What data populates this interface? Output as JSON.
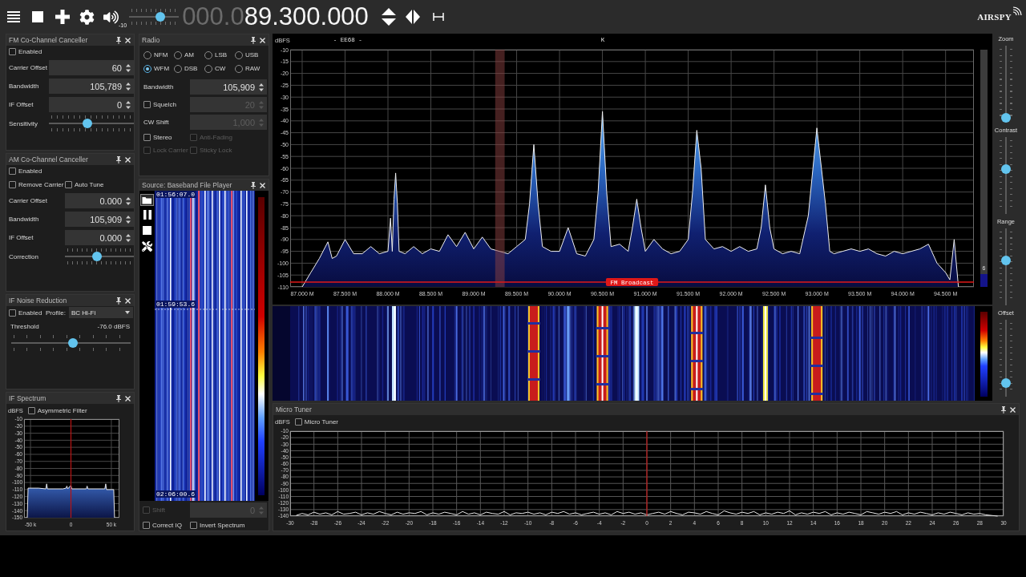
{
  "toolbar": {
    "volume": {
      "reading": "-10",
      "level": 0.65
    },
    "frequency": {
      "leading": "000.0",
      "value": "89.300.000"
    },
    "logo": "AIRSPY"
  },
  "left_panels": [
    {
      "kind": "form",
      "title": "FM Co-Channel Canceller",
      "rows": [
        {
          "kind": "checkbox",
          "label": "Enabled",
          "checked": false,
          "disabled": false
        },
        {
          "kind": "spin",
          "label": "Carrier Offset",
          "value": "60",
          "disabled": false
        },
        {
          "kind": "spin",
          "label": "Bandwidth",
          "value": "105,789",
          "disabled": false
        },
        {
          "kind": "spin",
          "label": "IF Offset",
          "value": "0",
          "disabled": false
        },
        {
          "kind": "slider",
          "label": "Sensitivity",
          "level": 0.45
        }
      ]
    },
    {
      "kind": "form",
      "title": "AM Co-Channel Canceller",
      "rows": [
        {
          "kind": "checkbox",
          "label": "Enabled",
          "checked": false,
          "disabled": false
        },
        {
          "kind": "checkboxes",
          "items": [
            {
              "label": "Remove Carrier",
              "checked": false,
              "disabled": false
            },
            {
              "label": "Auto Tune",
              "checked": false,
              "disabled": false
            }
          ]
        },
        {
          "kind": "spin",
          "label": "Carrier Offset",
          "value": "0.000",
          "disabled": false
        },
        {
          "kind": "spin",
          "label": "Bandwidth",
          "value": "105,909",
          "disabled": false
        },
        {
          "kind": "spin",
          "label": "IF Offset",
          "value": "0.000",
          "disabled": false
        },
        {
          "kind": "slider",
          "label": "Correction",
          "level": 0.46
        }
      ]
    },
    {
      "kind": "form",
      "title": "IF Noise Reduction",
      "rows": [
        {
          "kind": "checkbox_dropdown",
          "checkbox": {
            "label": "Enabled",
            "checked": false,
            "disabled": false
          },
          "label": "Profile:",
          "value": "BC Hi-Fi"
        },
        {
          "kind": "reading",
          "label": "Threshold",
          "value": "-76.0 dBFS"
        },
        {
          "kind": "slider",
          "level": 0.52
        }
      ]
    },
    {
      "kind": "chart",
      "title": "IF Spectrum",
      "checkbox": {
        "label": "Asymmetric Filter",
        "checked": false,
        "disabled": false
      },
      "chart_data": {
        "type": "area",
        "ylabel": "dBFS",
        "x": [
          -54,
          -53,
          -40,
          -31,
          -30,
          -29,
          -10,
          -6,
          -5,
          -4,
          0,
          1,
          19,
          20,
          21,
          42,
          43,
          44,
          53,
          54
        ],
        "values": [
          -150,
          -108,
          -108,
          -109,
          -102,
          -109,
          -109,
          -108,
          -105,
          -109,
          -104,
          -109,
          -109,
          -105,
          -109,
          -109,
          -102,
          -110,
          -110,
          -150
        ],
        "color": "#e6e6e6",
        "xlim": [
          -58,
          60
        ],
        "ylim": [
          -150,
          -10
        ],
        "xticks": [
          {
            "value": -50,
            "label": "-50 k"
          },
          {
            "value": 0,
            "label": "0"
          },
          {
            "value": 50,
            "label": "50 k"
          }
        ],
        "yticks": [
          -10,
          -20,
          -30,
          -40,
          -50,
          -60,
          -70,
          -80,
          -90,
          -100,
          -110,
          -120,
          -130,
          -140,
          -150
        ],
        "grid": true,
        "ref_lines": [
          {
            "axis": "x",
            "value": 0,
            "color": "#b81414"
          }
        ]
      }
    }
  ],
  "middle_panels": [
    {
      "kind": "form",
      "title": "Radio",
      "rows": [
        {
          "kind": "radios",
          "items": [
            {
              "label": "NFM",
              "selected": false
            },
            {
              "label": "AM",
              "selected": false
            },
            {
              "label": "LSB",
              "selected": false
            },
            {
              "label": "USB",
              "selected": false
            },
            {
              "label": "WFM",
              "selected": true
            },
            {
              "label": "DSB",
              "selected": false
            },
            {
              "label": "CW",
              "selected": false
            },
            {
              "label": "RAW",
              "selected": false
            }
          ]
        },
        {
          "kind": "spin",
          "label": "Bandwidth",
          "value": "105,909",
          "disabled": false
        },
        {
          "kind": "check_spin",
          "checkbox": {
            "label": "Squelch",
            "checked": false,
            "disabled": false
          },
          "value": "20",
          "disabled": true
        },
        {
          "kind": "spin",
          "label": "CW Shift",
          "value": "1,000",
          "disabled": true
        },
        {
          "kind": "checkboxes",
          "items": [
            {
              "label": "Stereo",
              "checked": false,
              "disabled": false
            },
            {
              "label": "Anti-Fading",
              "checked": false,
              "disabled": true
            }
          ]
        },
        {
          "kind": "checkboxes",
          "items": [
            {
              "label": "Lock Carrier",
              "checked": false,
              "disabled": true
            },
            {
              "label": "Sticky Lock",
              "checked": false,
              "disabled": true
            }
          ]
        }
      ]
    },
    {
      "kind": "player",
      "title": "Source: Baseband File Player",
      "timestamps": [
        "01:56:07.0",
        "01:59:53.6",
        "02:06:00.6"
      ],
      "rows": [
        {
          "kind": "check_spin",
          "checkbox": {
            "label": "Shift",
            "checked": false,
            "disabled": true
          },
          "value": "0",
          "disabled": true
        },
        {
          "kind": "checkboxes",
          "items": [
            {
              "label": "Correct IQ",
              "checked": false,
              "disabled": false
            },
            {
              "label": "Invert Spectrum",
              "checked": false,
              "disabled": false
            }
          ]
        }
      ]
    }
  ],
  "spectrum": {
    "chart_data": {
      "type": "area",
      "ylabel": "dBFS",
      "annotations": [
        "- EE68 -",
        "K"
      ],
      "x": [
        87,
        87.1,
        87.2,
        87.3,
        87.35,
        87.4,
        87.5,
        87.6,
        87.7,
        87.8,
        87.9,
        88,
        88.03,
        88.05,
        88.07,
        88.09,
        88.11,
        88.13,
        88.2,
        88.3,
        88.4,
        88.5,
        88.6,
        88.7,
        88.8,
        88.9,
        89,
        89.1,
        89.2,
        89.3,
        89.4,
        89.5,
        89.6,
        89.65,
        89.7,
        89.75,
        89.8,
        89.9,
        90,
        90.1,
        90.2,
        90.3,
        90.4,
        90.45,
        90.5,
        90.55,
        90.6,
        90.7,
        90.8,
        90.85,
        90.9,
        90.95,
        91,
        91.1,
        91.2,
        91.3,
        91.4,
        91.5,
        91.55,
        91.6,
        91.65,
        91.7,
        91.8,
        91.9,
        92,
        92.1,
        92.2,
        92.3,
        92.35,
        92.4,
        92.45,
        92.5,
        92.6,
        92.7,
        92.8,
        92.9,
        93,
        93.1,
        93.15,
        93.2,
        93.3,
        93.4,
        93.5,
        93.6,
        93.7,
        93.8,
        93.9,
        94,
        94.1,
        94.2,
        94.3,
        94.4,
        94.5,
        94.55,
        94.6,
        94.65
      ],
      "values": [
        -110,
        -104,
        -98,
        -91,
        -98,
        -97,
        -90,
        -96,
        -96,
        -93,
        -96,
        -95,
        -81,
        -95,
        -73,
        -62,
        -75,
        -95,
        -96,
        -93,
        -96,
        -94,
        -95,
        -88,
        -93,
        -87,
        -94,
        -89,
        -94,
        -95,
        -96,
        -93,
        -90,
        -75,
        -50,
        -75,
        -93,
        -95,
        -95,
        -85,
        -96,
        -97,
        -90,
        -70,
        -36,
        -70,
        -93,
        -92,
        -95,
        -85,
        -73,
        -85,
        -95,
        -90,
        -94,
        -96,
        -95,
        -90,
        -70,
        -44,
        -60,
        -90,
        -94,
        -93,
        -95,
        -93,
        -95,
        -94,
        -85,
        -67,
        -85,
        -94,
        -96,
        -95,
        -96,
        -80,
        -43,
        -75,
        -95,
        -96,
        -95,
        -94,
        -95,
        -94,
        -96,
        -97,
        -95,
        -96,
        -95,
        -94,
        -92,
        -100,
        -104,
        -107,
        -90,
        -110
      ],
      "color": "#f0f0f0",
      "xlim": [
        86.86,
        94.83
      ],
      "ylim": [
        -110,
        -10
      ],
      "xticks": [
        {
          "value": 87,
          "label": "87.000 M"
        },
        {
          "value": 87.5,
          "label": "87.500 M"
        },
        {
          "value": 88,
          "label": "88.000 M"
        },
        {
          "value": 88.5,
          "label": "88.500 M"
        },
        {
          "value": 89,
          "label": "89.000 M"
        },
        {
          "value": 89.5,
          "label": "89.500 M"
        },
        {
          "value": 90,
          "label": "90.000 M"
        },
        {
          "value": 90.5,
          "label": "90.500 M"
        },
        {
          "value": 91,
          "label": "91.000 M"
        },
        {
          "value": 91.5,
          "label": "91.500 M"
        },
        {
          "value": 92,
          "label": "92.000 M"
        },
        {
          "value": 92.5,
          "label": "92.500 M"
        },
        {
          "value": 93,
          "label": "93.000 M"
        },
        {
          "value": 93.5,
          "label": "93.500 M"
        },
        {
          "value": 94,
          "label": "94.000 M"
        },
        {
          "value": 94.5,
          "label": "94.500 M"
        }
      ],
      "yticks": [
        -10,
        -15,
        -20,
        -25,
        -30,
        -35,
        -40,
        -45,
        -50,
        -55,
        -60,
        -65,
        -70,
        -75,
        -80,
        -85,
        -90,
        -95,
        -100,
        -105,
        -110
      ],
      "grid": true,
      "bands": [
        {
          "axis": "x",
          "from": 89.25,
          "to": 89.36,
          "color": "#8a4040"
        }
      ],
      "ref_lines": [
        {
          "axis": "y",
          "value": -108,
          "label": "FM Broadcast",
          "color": "#e01818"
        }
      ]
    },
    "meter": {
      "reading": "6",
      "level": 0.054
    }
  },
  "display_sliders": [
    {
      "label": "Zoom",
      "level": 0
    },
    {
      "label": "Contrast",
      "level": 0.6
    },
    {
      "label": "Range",
      "level": 0.59
    },
    {
      "label": "Offset",
      "level": 0.13
    }
  ],
  "micro_tuner": {
    "kind": "chart",
    "title": "Micro Tuner",
    "checkbox": {
      "label": "Micro Tuner",
      "checked": false,
      "disabled": false
    },
    "chart_data": {
      "type": "line",
      "ylabel": "dBFS",
      "x": [
        -29.5,
        -29,
        -28.5,
        -28,
        -27.5,
        -27,
        -26.5,
        -26,
        -25.5,
        -25,
        -24.5,
        -24,
        -23.5,
        -23,
        -22.5,
        -22,
        -21.5,
        -21,
        -20.5,
        -20,
        -19.5,
        -19,
        -18.5,
        -18,
        -17.5,
        -17,
        -16.5,
        -16,
        -15.5,
        -15,
        -14.5,
        -14,
        -13.5,
        -13,
        -12.5,
        -12,
        -11.5,
        -11,
        -10.5,
        -10,
        -9.5,
        -9,
        -8.5,
        -8,
        -7.5,
        -7,
        -6.5,
        -6,
        -5.5,
        -5,
        -4.5,
        -4,
        -3.5,
        -3,
        -2.5,
        -2,
        -1.5,
        -1,
        -0.5,
        0,
        0.5,
        1,
        1.5,
        2,
        2.5,
        3,
        3.5,
        4,
        4.5,
        5,
        5.5,
        6,
        6.5,
        7,
        7.5,
        8,
        8.5,
        9,
        9.5,
        10,
        10.5,
        11,
        11.5,
        12,
        12.5,
        13,
        13.5,
        14,
        14.5,
        15,
        15.5,
        16,
        16.5,
        17,
        17.5,
        18,
        18.5,
        19,
        19.5,
        20,
        20.5,
        21,
        21.5,
        22,
        22.5,
        23,
        23.5,
        24,
        24.5,
        25,
        25.5,
        26,
        26.5,
        27,
        27.5,
        28,
        28.5,
        29,
        29.5
      ],
      "values": [
        -139,
        -136,
        -138,
        -134,
        -137,
        -135,
        -138,
        -133,
        -137,
        -136,
        -134,
        -138,
        -135,
        -137,
        -133,
        -136,
        -138,
        -134,
        -137,
        -135,
        -136,
        -133,
        -138,
        -135,
        -137,
        -134,
        -136,
        -138,
        -133,
        -137,
        -135,
        -138,
        -134,
        -136,
        -137,
        -133,
        -138,
        -135,
        -136,
        -134,
        -137,
        -135,
        -138,
        -134,
        -136,
        -133,
        -137,
        -135,
        -138,
        -136,
        -134,
        -137,
        -135,
        -138,
        -133,
        -136,
        -134,
        -137,
        -135,
        -138,
        -136,
        -134,
        -137,
        -133,
        -136,
        -138,
        -134,
        -135,
        -137,
        -133,
        -136,
        -138,
        -132,
        -135,
        -137,
        -134,
        -136,
        -133,
        -138,
        -135,
        -137,
        -134,
        -136,
        -132,
        -138,
        -135,
        -137,
        -134,
        -136,
        -133,
        -138,
        -135,
        -137,
        -134,
        -136,
        -138,
        -133,
        -135,
        -137,
        -134,
        -136,
        -133,
        -138,
        -135,
        -137,
        -134,
        -136,
        -138,
        -135,
        -137,
        -134,
        -136,
        -138,
        -135,
        -137,
        -136,
        -138,
        -139,
        -140
      ],
      "color": "#e8e8e8",
      "xlim": [
        -30,
        30
      ],
      "ylim": [
        -140,
        -10
      ],
      "xticks": [
        -30,
        -28,
        -26,
        -24,
        -22,
        -20,
        -18,
        -16,
        -14,
        -12,
        -10,
        -8,
        -6,
        -4,
        -2,
        0,
        2,
        4,
        6,
        8,
        10,
        12,
        14,
        16,
        18,
        20,
        22,
        24,
        26,
        28,
        30
      ],
      "yticks": [
        -10,
        -20,
        -30,
        -40,
        -50,
        -60,
        -70,
        -80,
        -90,
        -100,
        -110,
        -120,
        -130,
        -140
      ],
      "grid": true,
      "ref_lines": [
        {
          "axis": "x",
          "value": 0,
          "color": "#c01818"
        }
      ]
    }
  }
}
